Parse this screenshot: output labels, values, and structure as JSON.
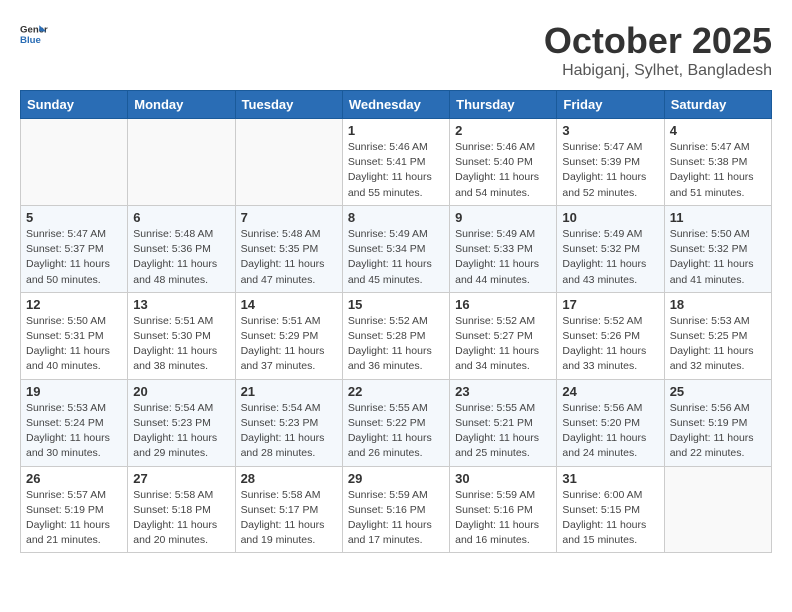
{
  "header": {
    "logo_line1": "General",
    "logo_line2": "Blue",
    "month": "October 2025",
    "location": "Habiganj, Sylhet, Bangladesh"
  },
  "weekdays": [
    "Sunday",
    "Monday",
    "Tuesday",
    "Wednesday",
    "Thursday",
    "Friday",
    "Saturday"
  ],
  "weeks": [
    [
      {
        "day": "",
        "info": ""
      },
      {
        "day": "",
        "info": ""
      },
      {
        "day": "",
        "info": ""
      },
      {
        "day": "1",
        "info": "Sunrise: 5:46 AM\nSunset: 5:41 PM\nDaylight: 11 hours\nand 55 minutes."
      },
      {
        "day": "2",
        "info": "Sunrise: 5:46 AM\nSunset: 5:40 PM\nDaylight: 11 hours\nand 54 minutes."
      },
      {
        "day": "3",
        "info": "Sunrise: 5:47 AM\nSunset: 5:39 PM\nDaylight: 11 hours\nand 52 minutes."
      },
      {
        "day": "4",
        "info": "Sunrise: 5:47 AM\nSunset: 5:38 PM\nDaylight: 11 hours\nand 51 minutes."
      }
    ],
    [
      {
        "day": "5",
        "info": "Sunrise: 5:47 AM\nSunset: 5:37 PM\nDaylight: 11 hours\nand 50 minutes."
      },
      {
        "day": "6",
        "info": "Sunrise: 5:48 AM\nSunset: 5:36 PM\nDaylight: 11 hours\nand 48 minutes."
      },
      {
        "day": "7",
        "info": "Sunrise: 5:48 AM\nSunset: 5:35 PM\nDaylight: 11 hours\nand 47 minutes."
      },
      {
        "day": "8",
        "info": "Sunrise: 5:49 AM\nSunset: 5:34 PM\nDaylight: 11 hours\nand 45 minutes."
      },
      {
        "day": "9",
        "info": "Sunrise: 5:49 AM\nSunset: 5:33 PM\nDaylight: 11 hours\nand 44 minutes."
      },
      {
        "day": "10",
        "info": "Sunrise: 5:49 AM\nSunset: 5:32 PM\nDaylight: 11 hours\nand 43 minutes."
      },
      {
        "day": "11",
        "info": "Sunrise: 5:50 AM\nSunset: 5:32 PM\nDaylight: 11 hours\nand 41 minutes."
      }
    ],
    [
      {
        "day": "12",
        "info": "Sunrise: 5:50 AM\nSunset: 5:31 PM\nDaylight: 11 hours\nand 40 minutes."
      },
      {
        "day": "13",
        "info": "Sunrise: 5:51 AM\nSunset: 5:30 PM\nDaylight: 11 hours\nand 38 minutes."
      },
      {
        "day": "14",
        "info": "Sunrise: 5:51 AM\nSunset: 5:29 PM\nDaylight: 11 hours\nand 37 minutes."
      },
      {
        "day": "15",
        "info": "Sunrise: 5:52 AM\nSunset: 5:28 PM\nDaylight: 11 hours\nand 36 minutes."
      },
      {
        "day": "16",
        "info": "Sunrise: 5:52 AM\nSunset: 5:27 PM\nDaylight: 11 hours\nand 34 minutes."
      },
      {
        "day": "17",
        "info": "Sunrise: 5:52 AM\nSunset: 5:26 PM\nDaylight: 11 hours\nand 33 minutes."
      },
      {
        "day": "18",
        "info": "Sunrise: 5:53 AM\nSunset: 5:25 PM\nDaylight: 11 hours\nand 32 minutes."
      }
    ],
    [
      {
        "day": "19",
        "info": "Sunrise: 5:53 AM\nSunset: 5:24 PM\nDaylight: 11 hours\nand 30 minutes."
      },
      {
        "day": "20",
        "info": "Sunrise: 5:54 AM\nSunset: 5:23 PM\nDaylight: 11 hours\nand 29 minutes."
      },
      {
        "day": "21",
        "info": "Sunrise: 5:54 AM\nSunset: 5:23 PM\nDaylight: 11 hours\nand 28 minutes."
      },
      {
        "day": "22",
        "info": "Sunrise: 5:55 AM\nSunset: 5:22 PM\nDaylight: 11 hours\nand 26 minutes."
      },
      {
        "day": "23",
        "info": "Sunrise: 5:55 AM\nSunset: 5:21 PM\nDaylight: 11 hours\nand 25 minutes."
      },
      {
        "day": "24",
        "info": "Sunrise: 5:56 AM\nSunset: 5:20 PM\nDaylight: 11 hours\nand 24 minutes."
      },
      {
        "day": "25",
        "info": "Sunrise: 5:56 AM\nSunset: 5:19 PM\nDaylight: 11 hours\nand 22 minutes."
      }
    ],
    [
      {
        "day": "26",
        "info": "Sunrise: 5:57 AM\nSunset: 5:19 PM\nDaylight: 11 hours\nand 21 minutes."
      },
      {
        "day": "27",
        "info": "Sunrise: 5:58 AM\nSunset: 5:18 PM\nDaylight: 11 hours\nand 20 minutes."
      },
      {
        "day": "28",
        "info": "Sunrise: 5:58 AM\nSunset: 5:17 PM\nDaylight: 11 hours\nand 19 minutes."
      },
      {
        "day": "29",
        "info": "Sunrise: 5:59 AM\nSunset: 5:16 PM\nDaylight: 11 hours\nand 17 minutes."
      },
      {
        "day": "30",
        "info": "Sunrise: 5:59 AM\nSunset: 5:16 PM\nDaylight: 11 hours\nand 16 minutes."
      },
      {
        "day": "31",
        "info": "Sunrise: 6:00 AM\nSunset: 5:15 PM\nDaylight: 11 hours\nand 15 minutes."
      },
      {
        "day": "",
        "info": ""
      }
    ]
  ]
}
